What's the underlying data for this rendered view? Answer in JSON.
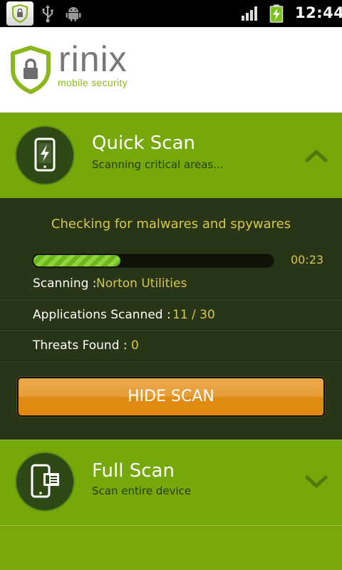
{
  "status_bar": {
    "time": "12:44",
    "icons": [
      "app-shield-icon",
      "usb-icon",
      "android-debug-icon",
      "signal-icon",
      "battery-charging-icon"
    ]
  },
  "header": {
    "app_name": "rinix",
    "tagline": "mobile security",
    "logo_icon": "shield-lock-icon"
  },
  "quick_scan": {
    "title": "Quick Scan",
    "subtitle": "Scanning critical areas...",
    "icon": "phone-lightning-icon",
    "expand_icon": "chevron-up-icon"
  },
  "scan_panel": {
    "heading": "Checking for malwares and spywares",
    "progress": 0.36,
    "elapsed": "00:23",
    "scanning_label": "Scanning :",
    "scanning_value": "Norton Utilities",
    "apps_label": "Applications Scanned :",
    "apps_value": "11 / 30",
    "threats_label": "Threats Found :",
    "threats_value": "0",
    "hide_button": "HIDE SCAN"
  },
  "full_scan": {
    "title": "Full Scan",
    "subtitle": "Scan entire device",
    "icon": "phone-card-icon",
    "expand_icon": "chevron-down-icon"
  },
  "colors": {
    "green": "#76a80a",
    "dark_panel": "#283517",
    "accent_yellow": "#d8c84a",
    "button_orange": "#e08a10"
  }
}
